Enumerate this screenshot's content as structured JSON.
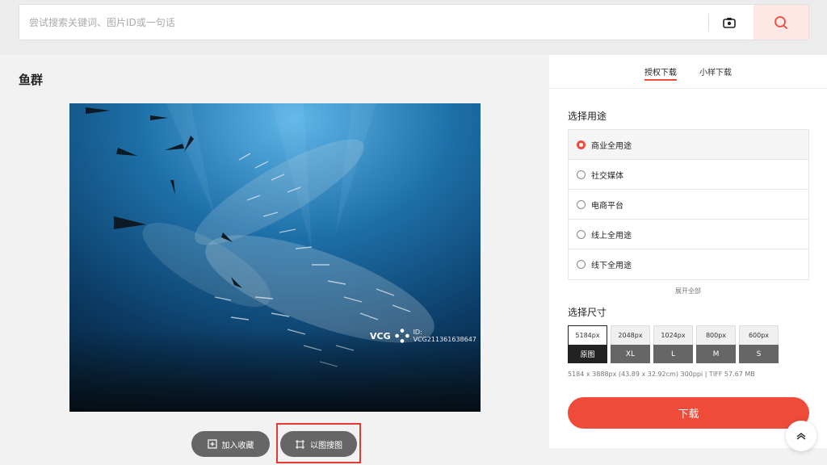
{
  "search": {
    "placeholder": "尝试搜索关键词、图片ID或一句话"
  },
  "image": {
    "title": "鱼群",
    "watermark_brand": "VCG",
    "watermark_id": "ID: VCG211361638647"
  },
  "actions": {
    "favorite_label": "加入收藏",
    "similar_label": "以图搜图"
  },
  "panel": {
    "tabs": [
      {
        "label": "授权下载"
      },
      {
        "label": "小样下载"
      }
    ],
    "usage_title": "选择用途",
    "uses": [
      {
        "label": "商业全用途"
      },
      {
        "label": "社交媒体"
      },
      {
        "label": "电商平台"
      },
      {
        "label": "线上全用途"
      },
      {
        "label": "线下全用途"
      }
    ],
    "expand_label": "展开全部",
    "size_title": "选择尺寸",
    "sizes": [
      {
        "px": "5184px",
        "label": "原图"
      },
      {
        "px": "2048px",
        "label": "XL"
      },
      {
        "px": "1024px",
        "label": "L"
      },
      {
        "px": "800px",
        "label": "M"
      },
      {
        "px": "600px",
        "label": "S"
      }
    ],
    "meta": "5184 x 3888px (43.89 x 32.92cm) 300ppi | TIFF 57.67 MB",
    "download_label": "下载"
  },
  "colors": {
    "accent": "#ef4b3a",
    "search_button_bg": "#fde8e5"
  }
}
